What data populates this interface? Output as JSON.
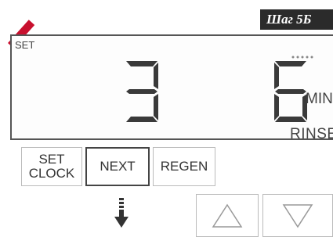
{
  "banner": {
    "step_text": "Шаг 5Б"
  },
  "display": {
    "indicator": "SET",
    "digit_left": "3",
    "digit_right": "6",
    "unit": "MIN",
    "mode": "RINSE"
  },
  "buttons": {
    "set_clock_line1": "SET",
    "set_clock_line2": "CLOCK",
    "next": "NEXT",
    "regen": "REGEN"
  },
  "colors": {
    "accent_red": "#c8102e",
    "banner_bg": "#2b2b2b",
    "segment": "#3a3a3a"
  },
  "icons": {
    "up": "triangle-up-icon",
    "down": "triangle-down-icon",
    "pointer": "arrow-down-icon"
  }
}
